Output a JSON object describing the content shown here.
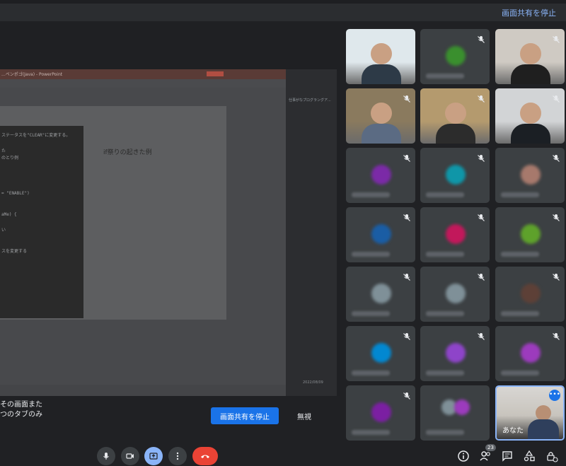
{
  "top_bar": {
    "stop_share_link": "画面共有を停止"
  },
  "presentation": {
    "window_title": "...ペンポゴ(Java) - PowerPoint",
    "slide_title": "if祭りの起きた例",
    "code_lines": [
      "ステータスを\"CLEAR\"に変更する。",
      "た",
      "のとり例",
      "= \"ENABLE\")",
      "aMe) {",
      "い",
      "スを変更する"
    ],
    "taskbar_label": "仕事がなプログラングア...",
    "date_time": "2022/08/09"
  },
  "share_prompt": {
    "notice_lines": [
      "その画面また",
      "つのタブのみ"
    ],
    "stop_button": "画面共有を停止",
    "ignore_button": "無視"
  },
  "participants": [
    {
      "type": "video",
      "muted": false,
      "colors": [
        "#dfe8ec",
        "#2d3a47"
      ]
    },
    {
      "type": "avatar",
      "muted": true,
      "color": "#3a8f2e"
    },
    {
      "type": "video",
      "muted": true,
      "colors": [
        "#cfcac3",
        "#1f1f1f"
      ]
    },
    {
      "type": "video",
      "muted": true,
      "colors": [
        "#8a7a5e",
        "#5b6b83"
      ]
    },
    {
      "type": "video",
      "muted": true,
      "colors": [
        "#b49a6e",
        "#2c2c2c"
      ]
    },
    {
      "type": "video",
      "muted": true,
      "colors": [
        "#d2d4d6",
        "#1b1f24"
      ]
    },
    {
      "type": "avatar",
      "muted": true,
      "color": "#7b2aa7"
    },
    {
      "type": "avatar",
      "muted": true,
      "color": "#0f96a8"
    },
    {
      "type": "avatar",
      "muted": true,
      "color": "#a7796c"
    },
    {
      "type": "avatar",
      "muted": true,
      "color": "#1a5da4"
    },
    {
      "type": "avatar",
      "muted": true,
      "color": "#c2185b"
    },
    {
      "type": "avatar",
      "muted": true,
      "color": "#5ea12b"
    },
    {
      "type": "avatar",
      "muted": true,
      "color": "#7f9098"
    },
    {
      "type": "avatar",
      "muted": true,
      "color": "#7f9098"
    },
    {
      "type": "avatar",
      "muted": true,
      "color": "#5d4037"
    },
    {
      "type": "avatar",
      "muted": true,
      "color": "#0288d1"
    },
    {
      "type": "avatar",
      "muted": true,
      "color": "#8e44c9"
    },
    {
      "type": "avatar",
      "muted": true,
      "color": "#9c3bbd"
    },
    {
      "type": "avatar",
      "muted": true,
      "color": "#7b1fa2"
    },
    {
      "type": "group",
      "muted": false,
      "color": "#7f9098"
    },
    {
      "type": "you",
      "muted": false,
      "label": "あなた"
    }
  ],
  "controls": {
    "mic_icon": "mic-icon",
    "camera_icon": "camera-icon",
    "present_icon": "present-screen-icon",
    "more_icon": "more-vert-icon",
    "end_call_icon": "end-call-icon"
  },
  "right_controls": {
    "people_count": "23",
    "icons": [
      "info-icon",
      "people-icon",
      "chat-icon",
      "activities-icon",
      "host-controls-icon"
    ]
  },
  "colors": {
    "accent": "#1a73e8",
    "end_call": "#ea4335",
    "highlight": "#8ab4f8"
  }
}
